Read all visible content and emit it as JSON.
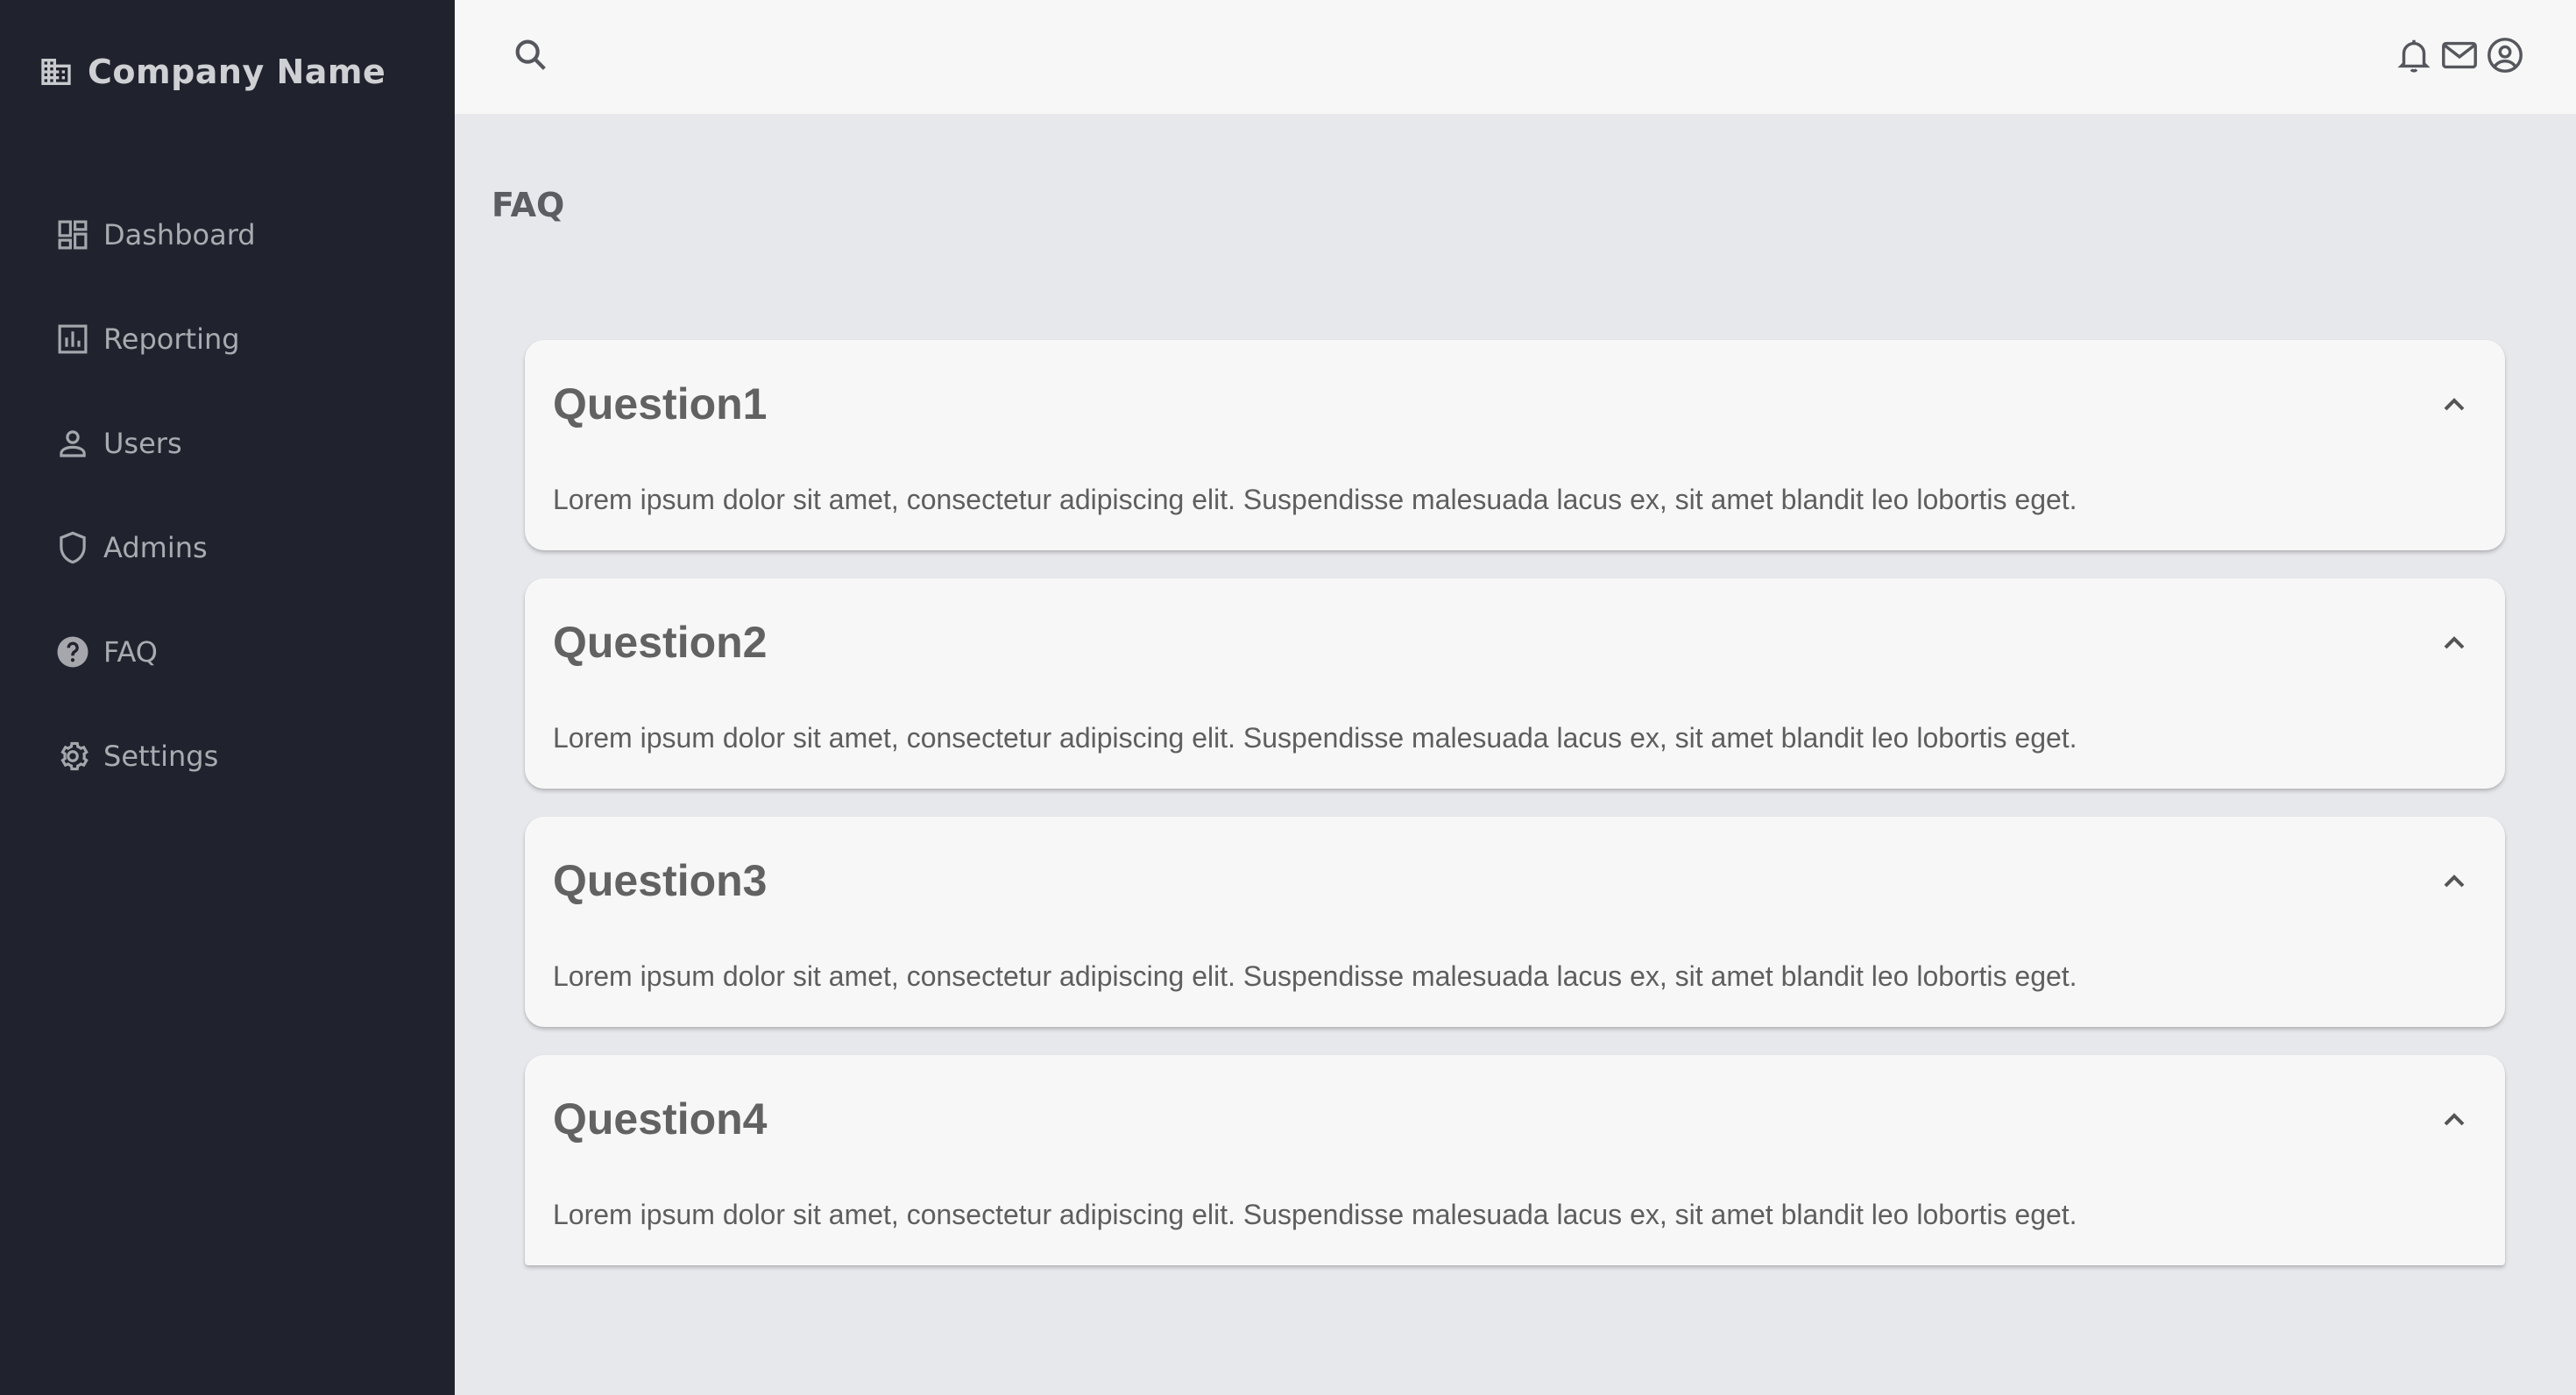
{
  "sidebar": {
    "brand": {
      "name": "Company Name",
      "icon": "building-icon"
    },
    "items": [
      {
        "label": "Dashboard",
        "icon": "dashboard-icon"
      },
      {
        "label": "Reporting",
        "icon": "bar-chart-icon"
      },
      {
        "label": "Users",
        "icon": "user-icon"
      },
      {
        "label": "Admins",
        "icon": "shield-icon"
      },
      {
        "label": "FAQ",
        "icon": "help-circle-icon"
      },
      {
        "label": "Settings",
        "icon": "gear-icon"
      }
    ]
  },
  "topbar": {
    "icons": [
      "search-icon",
      "bell-icon",
      "mail-icon",
      "account-circle-icon"
    ]
  },
  "page": {
    "title": "FAQ"
  },
  "faq": [
    {
      "question": "Question1",
      "answer": "Lorem ipsum dolor sit amet, consectetur adipiscing elit. Suspendisse malesuada lacus ex, sit amet blandit leo lobortis eget."
    },
    {
      "question": "Question2",
      "answer": "Lorem ipsum dolor sit amet, consectetur adipiscing elit. Suspendisse malesuada lacus ex, sit amet blandit leo lobortis eget."
    },
    {
      "question": "Question3",
      "answer": "Lorem ipsum dolor sit amet, consectetur adipiscing elit. Suspendisse malesuada lacus ex, sit amet blandit leo lobortis eget."
    },
    {
      "question": "Question4",
      "answer": "Lorem ipsum dolor sit amet, consectetur adipiscing elit. Suspendisse malesuada lacus ex, sit amet blandit leo lobortis eget."
    }
  ],
  "colors": {
    "sidebar_bg": "#20232d",
    "main_bg": "#e7e8ec",
    "card_bg": "#f7f7f7",
    "text_muted": "#a9abb1"
  }
}
